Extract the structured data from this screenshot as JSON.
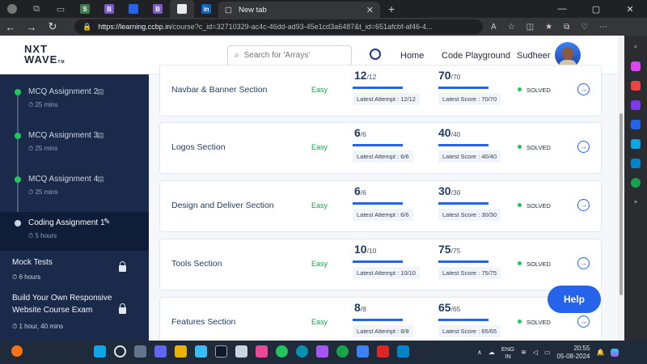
{
  "browser": {
    "tab_active_title": "New tab",
    "url_host": "https://learning.ccbp.in",
    "url_path": "/course?c_id=32710329-ac4c-46dd-ad93-45e1cd3a6487&t_id=651afcbf-af46-4..."
  },
  "header": {
    "logo_line1": "NXT",
    "logo_line2": "WAVE",
    "logo_tm": "TM",
    "search_placeholder": "Search for 'Arrays'",
    "home": "Home",
    "code_playground": "Code Playground",
    "user_name": "Sudheer"
  },
  "sidebar": {
    "items": [
      {
        "title": "MCQ Assignment 2",
        "duration": "25 mins"
      },
      {
        "title": "MCQ Assignment 3",
        "duration": "25 mins"
      },
      {
        "title": "MCQ Assignment 4",
        "duration": "25 mins"
      },
      {
        "title": "Coding Assignment 1",
        "duration": "5 hours"
      }
    ],
    "sections": [
      {
        "title": "Mock Tests",
        "duration": "6 hours"
      },
      {
        "title_line1": "Build Your Own Responsive",
        "title_line2": "Website Course Exam",
        "duration": "1 hour, 40 mins"
      }
    ]
  },
  "cards": [
    {
      "name": "Navbar & Banner Section",
      "difficulty": "Easy",
      "attempt": "12",
      "attempt_total": "/12",
      "attempt_label": "Latest Attempt : 12/12",
      "score": "70",
      "score_total": "/70",
      "score_label": "Latest Score : 70/70",
      "status": "SOLVED"
    },
    {
      "name": "Logos Section",
      "difficulty": "Easy",
      "attempt": "6",
      "attempt_total": "/6",
      "attempt_label": "Latest Attempt : 6/6",
      "score": "40",
      "score_total": "/40",
      "score_label": "Latest Score : 40/40",
      "status": "SOLVED"
    },
    {
      "name": "Design and Deliver Section",
      "difficulty": "Easy",
      "attempt": "6",
      "attempt_total": "/6",
      "attempt_label": "Latest Attempt : 6/6",
      "score": "30",
      "score_total": "/30",
      "score_label": "Latest Score : 30/30",
      "status": "SOLVED"
    },
    {
      "name": "Tools Section",
      "difficulty": "Easy",
      "attempt": "10",
      "attempt_total": "/10",
      "attempt_label": "Latest Attempt : 10/10",
      "score": "75",
      "score_total": "/75",
      "score_label": "Latest Score : 75/75",
      "status": "SOLVED"
    },
    {
      "name": "Features Section",
      "difficulty": "Easy",
      "attempt": "8",
      "attempt_total": "/8",
      "attempt_label": "Latest Attempt : 8/8",
      "score": "65",
      "score_total": "/65",
      "score_label": "Latest Score : 65/65",
      "status": "SOLVED"
    }
  ],
  "help_label": "Help",
  "taskbar": {
    "lang_line1": "ENG",
    "lang_line2": "IN",
    "time": "20:55",
    "date": "05-08-2024"
  },
  "colors": {
    "accent": "#2563eb",
    "sidebar": "#1b2a4a",
    "easy": "#16a34a",
    "solved_dot": "#22c55e"
  }
}
